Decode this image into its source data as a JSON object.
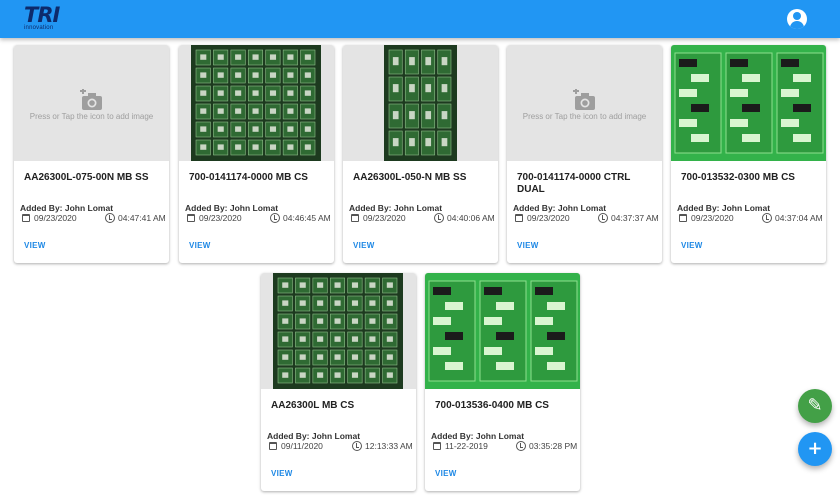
{
  "app": {
    "logo_text": "TRI",
    "logo_sub": "innovation"
  },
  "placeholder_text": "Press or Tap the icon to add image",
  "view_label": "VIEW",
  "added_prefix": "Added By: ",
  "cards": [
    {
      "title": "AA26300L-075-00N MB SS",
      "added_by": "Added By: John Lomat",
      "date": "09/23/2020",
      "time": "04:47:41 AM",
      "image": "none",
      "view": "VIEW"
    },
    {
      "title": "700-0141174-0000 MB CS",
      "added_by": "Added By: John Lomat",
      "date": "09/23/2020",
      "time": "04:46:45 AM",
      "image": "pcb-panel-dark",
      "view": "VIEW"
    },
    {
      "title": "AA26300L-050-N MB SS",
      "added_by": "Added By: John Lomat",
      "date": "09/23/2020",
      "time": "04:40:06 AM",
      "image": "pcb-panel-narrow",
      "view": "VIEW"
    },
    {
      "title": "700-0141174-0000 CTRL DUAL",
      "added_by": "Added By: John Lomat",
      "date": "09/23/2020",
      "time": "04:37:37 AM",
      "image": "none",
      "view": "VIEW"
    },
    {
      "title": "700-013532-0300 MB CS",
      "added_by": "Added By: John Lomat",
      "date": "09/23/2020",
      "time": "04:37:04 AM",
      "image": "pcb-board-green",
      "view": "VIEW"
    },
    {
      "title": "AA26300L MB CS",
      "added_by": "Added By: John Lomat",
      "date": "09/11/2020",
      "time": "12:13:33 AM",
      "image": "pcb-panel-dark",
      "view": "VIEW"
    },
    {
      "title": "700-013536-0400 MB CS",
      "added_by": "Added By: John Lomat",
      "date": "11-22-2019",
      "time": "03:35:28 PM",
      "image": "pcb-board-green",
      "view": "VIEW"
    }
  ],
  "icons": {
    "account": "account-circle-icon",
    "camera": "add-photo-icon",
    "calendar": "calendar-icon",
    "clock": "clock-icon",
    "edit": "pencil-icon",
    "add": "plus-icon"
  },
  "colors": {
    "appbar": "#2196f3",
    "link": "#1e88e5",
    "fab_edit": "#43a047",
    "fab_add": "#2196f3",
    "pcb_green": "#2e7d32"
  }
}
